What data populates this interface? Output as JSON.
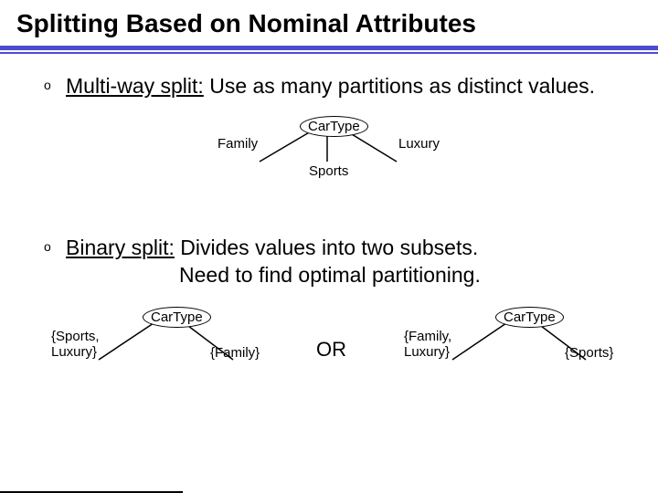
{
  "title": "Splitting Based on Nominal Attributes",
  "bullets": {
    "b1_underline": "Multi-way split:",
    "b1_rest": " Use as many partitions as distinct values.",
    "b2_underline": "Binary split:",
    "b2_rest": "  Divides values into two subsets.",
    "b2_line2": "Need to find optimal partitioning."
  },
  "diagram1": {
    "node": "CarType",
    "left": "Family",
    "mid": "Sports",
    "right": "Luxury"
  },
  "diagram2": {
    "left_node": "CarType",
    "left_l": "{Sports,\nLuxury}",
    "left_r": "{Family}",
    "or": "OR",
    "right_node": "CarType",
    "right_l": "{Family,\nLuxury}",
    "right_r": "{Sports}"
  }
}
